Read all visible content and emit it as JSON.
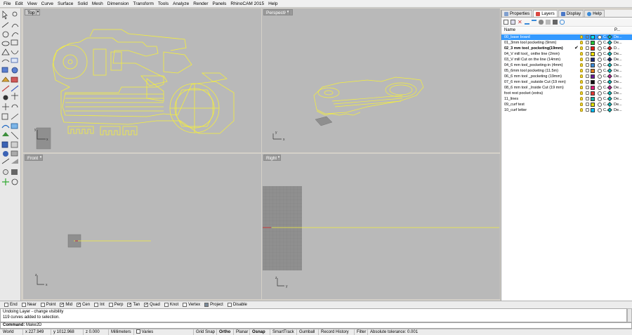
{
  "menu": [
    "File",
    "Edit",
    "View",
    "Curve",
    "Surface",
    "Solid",
    "Mesh",
    "Dimension",
    "Transform",
    "Tools",
    "Analyze",
    "Render",
    "Panels",
    "RhinoCAM 2015",
    "Help"
  ],
  "viewports": {
    "top": {
      "title": "Top",
      "x_label": "x",
      "y_label": "y"
    },
    "perspective": {
      "title": "Perspective",
      "x_label": "x",
      "y_label": "y"
    },
    "front": {
      "title": "Front",
      "x_label": "x",
      "y_label": "z"
    },
    "right": {
      "title": "Right",
      "x_label": "y",
      "y_label": "z"
    }
  },
  "panel": {
    "tabs": [
      "Properties",
      "Layers",
      "Display",
      "Help"
    ],
    "header": {
      "name": "Name",
      "print": "P..."
    },
    "layers": [
      {
        "name": "00_base board",
        "color": "#00e0ff",
        "diamond": "#00c8c8",
        "c": "C...",
        "de": "De...",
        "selected": true,
        "current": false
      },
      {
        "name": "01_3mm tool pocketing (9mm)",
        "color": "#22c13a",
        "diamond": "#00c8c8",
        "c": "C...",
        "de": "De...",
        "selected": false,
        "current": false
      },
      {
        "name": "02_3 mm tool_pocketing(19mm)",
        "color": "#e31b1b",
        "diamond": "#e31b1b",
        "c": "C...",
        "de": "D...",
        "selected": false,
        "current": true
      },
      {
        "name": "04_V mill tool_ onthe line (2mm)",
        "color": "#f0e000",
        "diamond": "#00c8c8",
        "c": "C...",
        "de": "De...",
        "selected": false,
        "current": false
      },
      {
        "name": "03_V mill Cut on the line (14mm)",
        "color": "#1d2b7a",
        "diamond": "#1d2b7a",
        "c": "C...",
        "de": "De...",
        "selected": false,
        "current": false
      },
      {
        "name": "04_6 mm tool_pocketing-in (4mm)",
        "color": "#3a8ad8",
        "diamond": "#00c8c8",
        "c": "C...",
        "de": "De...",
        "selected": false,
        "current": false
      },
      {
        "name": "05_6mm tool pocketing (11.5m)",
        "color": "#e07b1a",
        "diamond": "#00c8c8",
        "c": "C...",
        "de": "De...",
        "selected": false,
        "current": false
      },
      {
        "name": "06_6 mm tool _pocketing (19mm)",
        "color": "#6a1b9a",
        "diamond": "#c0209a",
        "c": "C...",
        "de": "De...",
        "selected": false,
        "current": false
      },
      {
        "name": "07_6 mm tool _outside Cut (19 mm)",
        "color": "#111111",
        "diamond": "#00c8c8",
        "c": "C...",
        "de": "De...",
        "selected": false,
        "current": false
      },
      {
        "name": "08_6 mm tool _Inside Cut (19 mm)",
        "color": "#e01c7a",
        "diamond": "#c0209a",
        "c": "C...",
        "de": "De...",
        "selected": false,
        "current": false
      },
      {
        "name": "foot rest pocket (extra)",
        "color": "#e53935",
        "diamond": "#00c8c8",
        "c": "C...",
        "de": "De...",
        "selected": false,
        "current": false
      },
      {
        "name": "11_lines",
        "color": "#14b2a8",
        "diamond": "#00c8c8",
        "c": "C...",
        "de": "De...",
        "selected": false,
        "current": false
      },
      {
        "name": "09_curf test",
        "color": "#e0e000",
        "diamond": "#00c8c8",
        "c": "C...",
        "de": "De...",
        "selected": false,
        "current": false
      },
      {
        "name": "10_curf letter",
        "color": "#00bfff",
        "diamond": "#00c8c8",
        "c": "C...",
        "de": "De...",
        "selected": false,
        "current": false
      }
    ]
  },
  "osnap": [
    {
      "label": "End",
      "checked": false
    },
    {
      "label": "Near",
      "checked": false
    },
    {
      "label": "Point",
      "checked": false
    },
    {
      "label": "Mid",
      "checked": true
    },
    {
      "label": "Cen",
      "checked": true
    },
    {
      "label": "Int",
      "checked": false
    },
    {
      "label": "Perp",
      "checked": false
    },
    {
      "label": "Tan",
      "checked": true
    },
    {
      "label": "Quad",
      "checked": true
    },
    {
      "label": "Knot",
      "checked": false
    },
    {
      "label": "Vertex",
      "checked": false
    },
    {
      "label": "Project",
      "checked": false,
      "filled": true
    },
    {
      "label": "Disable",
      "checked": false
    }
  ],
  "history": [
    "Undoing Layer - change visibility",
    "119 curves added to selection."
  ],
  "command": {
    "label": "Command:",
    "value": "Make2D"
  },
  "status": {
    "cplane": "World",
    "x": "x 227.949",
    "y": "y 1012.968",
    "z": "z 0.000",
    "units": "Millimeters",
    "layer": "Varies",
    "grid_snap": "Grid Snap",
    "ortho": "Ortho",
    "planar": "Planar",
    "osnap": "Osnap",
    "smarttrack": "SmartTrack",
    "gumball": "Gumball",
    "record_history": "Record History",
    "filter": "Filter",
    "tolerance": "Absolute tolerance: 0.001"
  },
  "colors": {
    "viewport_bg": "#b9b9b9",
    "curve": "#f5ef3b",
    "selection": "#3399ff",
    "grid_cell": "#8f8f8f"
  }
}
